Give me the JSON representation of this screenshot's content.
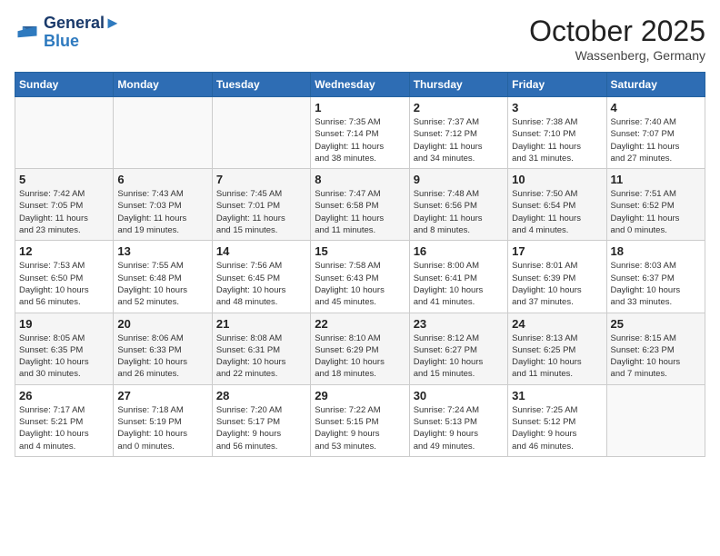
{
  "header": {
    "logo_line1": "General",
    "logo_line2": "Blue",
    "month": "October 2025",
    "location": "Wassenberg, Germany"
  },
  "weekdays": [
    "Sunday",
    "Monday",
    "Tuesday",
    "Wednesday",
    "Thursday",
    "Friday",
    "Saturday"
  ],
  "weeks": [
    [
      {
        "day": "",
        "info": ""
      },
      {
        "day": "",
        "info": ""
      },
      {
        "day": "",
        "info": ""
      },
      {
        "day": "1",
        "info": "Sunrise: 7:35 AM\nSunset: 7:14 PM\nDaylight: 11 hours\nand 38 minutes."
      },
      {
        "day": "2",
        "info": "Sunrise: 7:37 AM\nSunset: 7:12 PM\nDaylight: 11 hours\nand 34 minutes."
      },
      {
        "day": "3",
        "info": "Sunrise: 7:38 AM\nSunset: 7:10 PM\nDaylight: 11 hours\nand 31 minutes."
      },
      {
        "day": "4",
        "info": "Sunrise: 7:40 AM\nSunset: 7:07 PM\nDaylight: 11 hours\nand 27 minutes."
      }
    ],
    [
      {
        "day": "5",
        "info": "Sunrise: 7:42 AM\nSunset: 7:05 PM\nDaylight: 11 hours\nand 23 minutes."
      },
      {
        "day": "6",
        "info": "Sunrise: 7:43 AM\nSunset: 7:03 PM\nDaylight: 11 hours\nand 19 minutes."
      },
      {
        "day": "7",
        "info": "Sunrise: 7:45 AM\nSunset: 7:01 PM\nDaylight: 11 hours\nand 15 minutes."
      },
      {
        "day": "8",
        "info": "Sunrise: 7:47 AM\nSunset: 6:58 PM\nDaylight: 11 hours\nand 11 minutes."
      },
      {
        "day": "9",
        "info": "Sunrise: 7:48 AM\nSunset: 6:56 PM\nDaylight: 11 hours\nand 8 minutes."
      },
      {
        "day": "10",
        "info": "Sunrise: 7:50 AM\nSunset: 6:54 PM\nDaylight: 11 hours\nand 4 minutes."
      },
      {
        "day": "11",
        "info": "Sunrise: 7:51 AM\nSunset: 6:52 PM\nDaylight: 11 hours\nand 0 minutes."
      }
    ],
    [
      {
        "day": "12",
        "info": "Sunrise: 7:53 AM\nSunset: 6:50 PM\nDaylight: 10 hours\nand 56 minutes."
      },
      {
        "day": "13",
        "info": "Sunrise: 7:55 AM\nSunset: 6:48 PM\nDaylight: 10 hours\nand 52 minutes."
      },
      {
        "day": "14",
        "info": "Sunrise: 7:56 AM\nSunset: 6:45 PM\nDaylight: 10 hours\nand 48 minutes."
      },
      {
        "day": "15",
        "info": "Sunrise: 7:58 AM\nSunset: 6:43 PM\nDaylight: 10 hours\nand 45 minutes."
      },
      {
        "day": "16",
        "info": "Sunrise: 8:00 AM\nSunset: 6:41 PM\nDaylight: 10 hours\nand 41 minutes."
      },
      {
        "day": "17",
        "info": "Sunrise: 8:01 AM\nSunset: 6:39 PM\nDaylight: 10 hours\nand 37 minutes."
      },
      {
        "day": "18",
        "info": "Sunrise: 8:03 AM\nSunset: 6:37 PM\nDaylight: 10 hours\nand 33 minutes."
      }
    ],
    [
      {
        "day": "19",
        "info": "Sunrise: 8:05 AM\nSunset: 6:35 PM\nDaylight: 10 hours\nand 30 minutes."
      },
      {
        "day": "20",
        "info": "Sunrise: 8:06 AM\nSunset: 6:33 PM\nDaylight: 10 hours\nand 26 minutes."
      },
      {
        "day": "21",
        "info": "Sunrise: 8:08 AM\nSunset: 6:31 PM\nDaylight: 10 hours\nand 22 minutes."
      },
      {
        "day": "22",
        "info": "Sunrise: 8:10 AM\nSunset: 6:29 PM\nDaylight: 10 hours\nand 18 minutes."
      },
      {
        "day": "23",
        "info": "Sunrise: 8:12 AM\nSunset: 6:27 PM\nDaylight: 10 hours\nand 15 minutes."
      },
      {
        "day": "24",
        "info": "Sunrise: 8:13 AM\nSunset: 6:25 PM\nDaylight: 10 hours\nand 11 minutes."
      },
      {
        "day": "25",
        "info": "Sunrise: 8:15 AM\nSunset: 6:23 PM\nDaylight: 10 hours\nand 7 minutes."
      }
    ],
    [
      {
        "day": "26",
        "info": "Sunrise: 7:17 AM\nSunset: 5:21 PM\nDaylight: 10 hours\nand 4 minutes."
      },
      {
        "day": "27",
        "info": "Sunrise: 7:18 AM\nSunset: 5:19 PM\nDaylight: 10 hours\nand 0 minutes."
      },
      {
        "day": "28",
        "info": "Sunrise: 7:20 AM\nSunset: 5:17 PM\nDaylight: 9 hours\nand 56 minutes."
      },
      {
        "day": "29",
        "info": "Sunrise: 7:22 AM\nSunset: 5:15 PM\nDaylight: 9 hours\nand 53 minutes."
      },
      {
        "day": "30",
        "info": "Sunrise: 7:24 AM\nSunset: 5:13 PM\nDaylight: 9 hours\nand 49 minutes."
      },
      {
        "day": "31",
        "info": "Sunrise: 7:25 AM\nSunset: 5:12 PM\nDaylight: 9 hours\nand 46 minutes."
      },
      {
        "day": "",
        "info": ""
      }
    ]
  ]
}
